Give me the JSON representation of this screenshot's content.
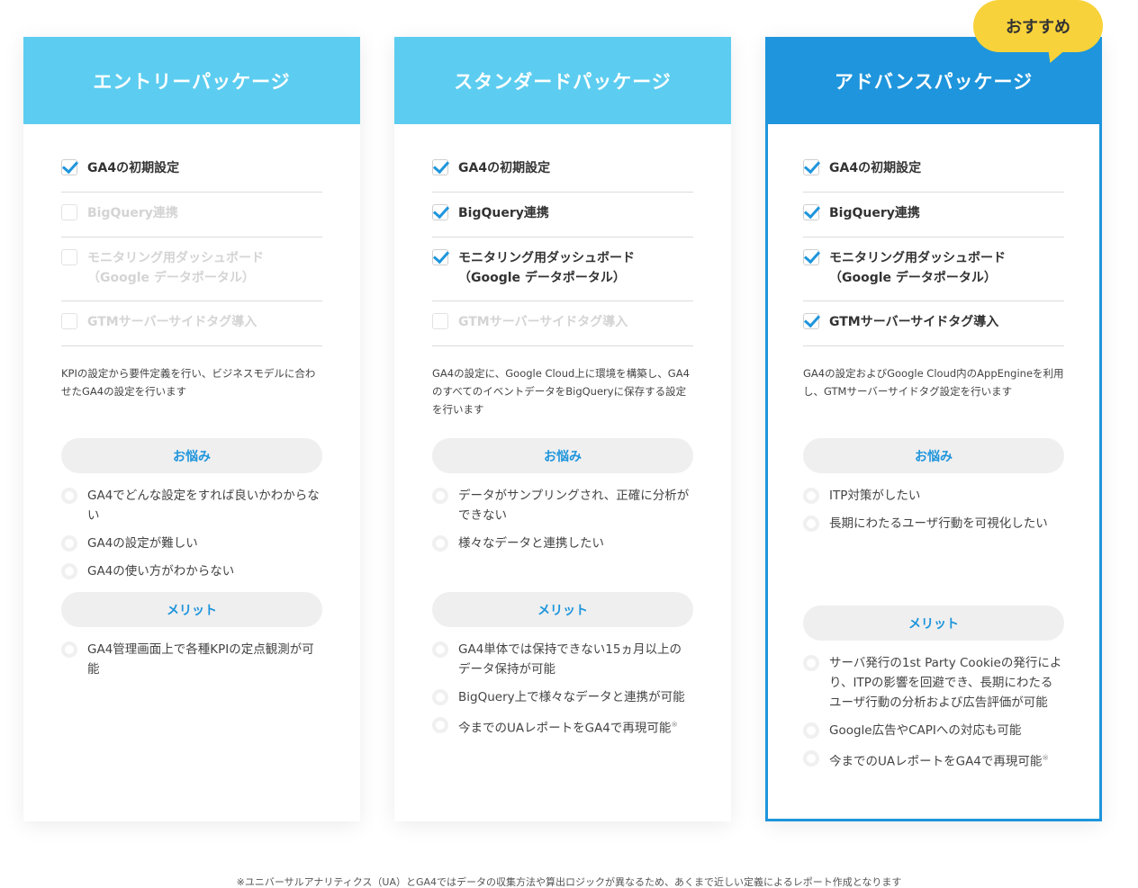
{
  "badge": "おすすめ",
  "cards": [
    {
      "title": "エントリーパッケージ",
      "features": [
        {
          "label": "GA4の初期設定",
          "checked": true
        },
        {
          "label": "BigQuery連携",
          "checked": false
        },
        {
          "label": "モニタリング用ダッシュボード\n（Google データポータル）",
          "checked": false
        },
        {
          "label": "GTMサーバーサイドタグ導入",
          "checked": false
        }
      ],
      "description": "KPIの設定から要件定義を行い、ビジネスモデルに合わせたGA4の設定を行います",
      "worries_label": "お悩み",
      "worries": [
        "GA4でどんな設定をすれば良いかわからない",
        "GA4の設定が難しい",
        "GA4の使い方がわからない"
      ],
      "merits_label": "メリット",
      "merits": [
        "GA4管理画面上で各種KPIの定点観測が可能"
      ]
    },
    {
      "title": "スタンダードパッケージ",
      "features": [
        {
          "label": "GA4の初期設定",
          "checked": true
        },
        {
          "label": "BigQuery連携",
          "checked": true
        },
        {
          "label": "モニタリング用ダッシュボード\n（Google データポータル）",
          "checked": true
        },
        {
          "label": "GTMサーバーサイドタグ導入",
          "checked": false
        }
      ],
      "description": "GA4の設定に、Google Cloud上に環境を構築し、GA4のすべてのイベントデータをBigQueryに保存する設定を行います",
      "worries_label": "お悩み",
      "worries": [
        "データがサンプリングされ、正確に分析ができない",
        "様々なデータと連携したい"
      ],
      "merits_label": "メリット",
      "merits": [
        "GA4単体では保持できない15ヵ月以上のデータ保持が可能",
        "BigQuery上で様々なデータと連携が可能",
        "今までのUAレポートをGA4で再現可能"
      ],
      "merit_note_mark": "※"
    },
    {
      "title": "アドバンスパッケージ",
      "features": [
        {
          "label": "GA4の初期設定",
          "checked": true
        },
        {
          "label": "BigQuery連携",
          "checked": true
        },
        {
          "label": "モニタリング用ダッシュボード\n（Google データポータル）",
          "checked": true
        },
        {
          "label": "GTMサーバーサイドタグ導入",
          "checked": true
        }
      ],
      "description": "GA4の設定およびGoogle Cloud内のAppEngineを利用し、GTMサーバーサイドタグ設定を行います",
      "worries_label": "お悩み",
      "worries": [
        "ITP対策がしたい",
        "長期にわたるユーザ行動を可視化したい"
      ],
      "merits_label": "メリット",
      "merits": [
        "サーバ発行の1st Party Cookieの発行により、ITPの影響を回避でき、長期にわたるユーザ行動の分析および広告評価が可能",
        "Google広告やCAPIへの対応も可能",
        "今までのUAレポートをGA4で再現可能"
      ],
      "merit_note_mark": "※"
    }
  ],
  "footnote": "※ユニバーサルアナリティクス（UA）とGA4ではデータの収集方法や算出ロジックが異なるため、あくまで近しい定義によるレポート作成となります"
}
